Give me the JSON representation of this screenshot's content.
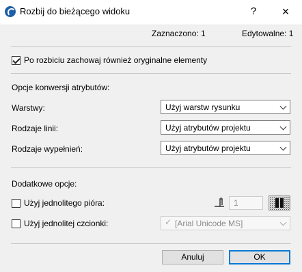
{
  "window": {
    "title": "Rozbij do bieżącego widoku",
    "help_label": "?",
    "close_label": "×"
  },
  "status": {
    "selected": "Zaznaczono: 1",
    "editable": "Edytowalne: 1"
  },
  "keep_original": {
    "label": "Po rozbiciu zachowaj również oryginalne elementy",
    "checked": true
  },
  "conversion": {
    "heading": "Opcje konwersji atrybutów:",
    "rows": [
      {
        "label": "Warstwy:",
        "value": "Użyj warstw rysunku"
      },
      {
        "label": "Rodzaje linii:",
        "value": "Użyj atrybutów projektu"
      },
      {
        "label": "Rodzaje wypełnień:",
        "value": "Użyj atrybutów projektu"
      }
    ]
  },
  "extra": {
    "heading": "Dodatkowe opcje:",
    "pen_label": "Użyj jednolitego pióra:",
    "pen_value": "1",
    "pen_icon": "pen-icon",
    "font_label": "Użyj jednolitej czcionki:",
    "font_value": "[Arial Unicode MS]"
  },
  "buttons": {
    "cancel": "Anuluj",
    "ok": "OK"
  },
  "colors": {
    "accent": "#0078d7",
    "app_icon": "#1d5fa8"
  }
}
